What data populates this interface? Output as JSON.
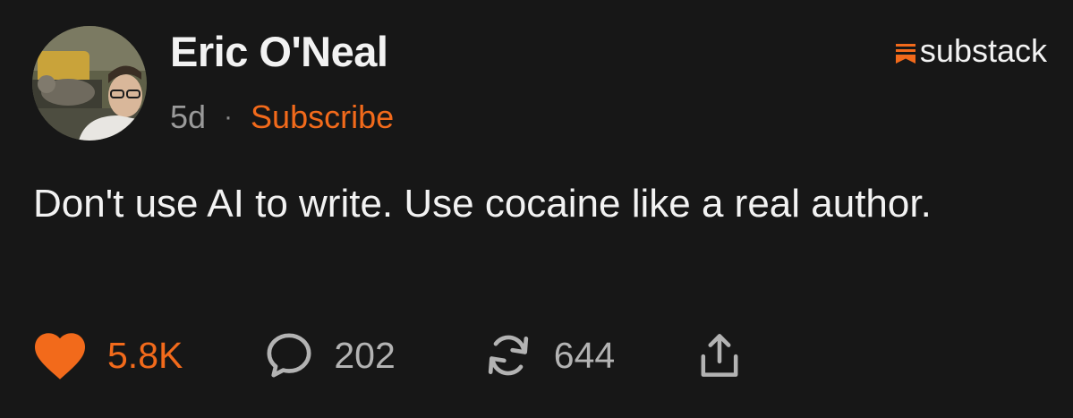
{
  "post": {
    "author": "Eric O'Neal",
    "age": "5d",
    "separator": "·",
    "subscribe_label": "Subscribe",
    "text": "Don't use AI to write. Use cocaine like a real author."
  },
  "brand": {
    "name": "substack",
    "color": "#f26a1b"
  },
  "actions": {
    "like_count": "5.8K",
    "comment_count": "202",
    "restack_count": "644"
  },
  "icons": {
    "avatar": "author-photo",
    "like": "heart-icon",
    "comment": "comment-bubble-icon",
    "restack": "restack-icon",
    "share": "share-icon"
  },
  "colors": {
    "background": "#171717",
    "accent": "#f26a1b",
    "text": "#f2f2f2",
    "muted": "#9a9a9a"
  }
}
